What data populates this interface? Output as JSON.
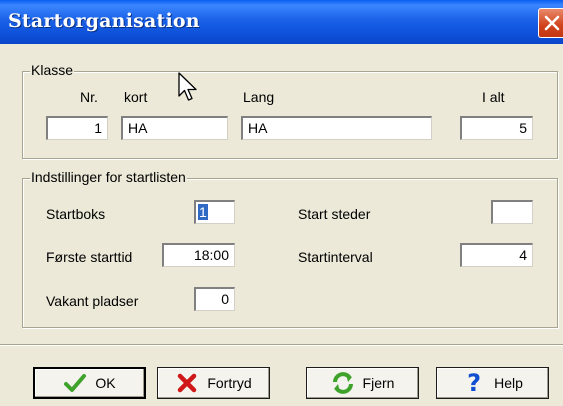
{
  "window": {
    "title": "Startorganisation"
  },
  "klasse": {
    "legend": "Klasse",
    "nr_label": "Nr.",
    "kort_label": "kort",
    "lang_label": "Lang",
    "ialt_label": "I alt",
    "nr_value": "1",
    "kort_value": "HA",
    "lang_value": "HA",
    "ialt_value": "5"
  },
  "settings": {
    "legend": "Indstillinger for startlisten",
    "startboks_label": "Startboks",
    "startboks_value": "1",
    "start_steder_label": "Start steder",
    "start_steder_value": "",
    "forste_starttid_label": "Første starttid",
    "forste_starttid_value": "18:00",
    "startinterval_label": "Startinterval",
    "startinterval_value": "4",
    "vakant_pladser_label": "Vakant pladser",
    "vakant_pladser_value": "0"
  },
  "buttons": {
    "ok": "OK",
    "fortryd": "Fortryd",
    "fjern": "Fjern",
    "help": "Help"
  },
  "icons": {
    "close": "close-icon",
    "ok": "checkmark-icon",
    "fortryd": "red-x-icon",
    "fjern": "refresh-icon",
    "help": "question-mark-icon"
  },
  "colors": {
    "titlebar": "#0d4fd8",
    "close_button": "#d0431c",
    "selection": "#316ac5",
    "check_green": "#3fa32b",
    "cancel_red": "#d11818",
    "help_blue": "#1050d0"
  }
}
